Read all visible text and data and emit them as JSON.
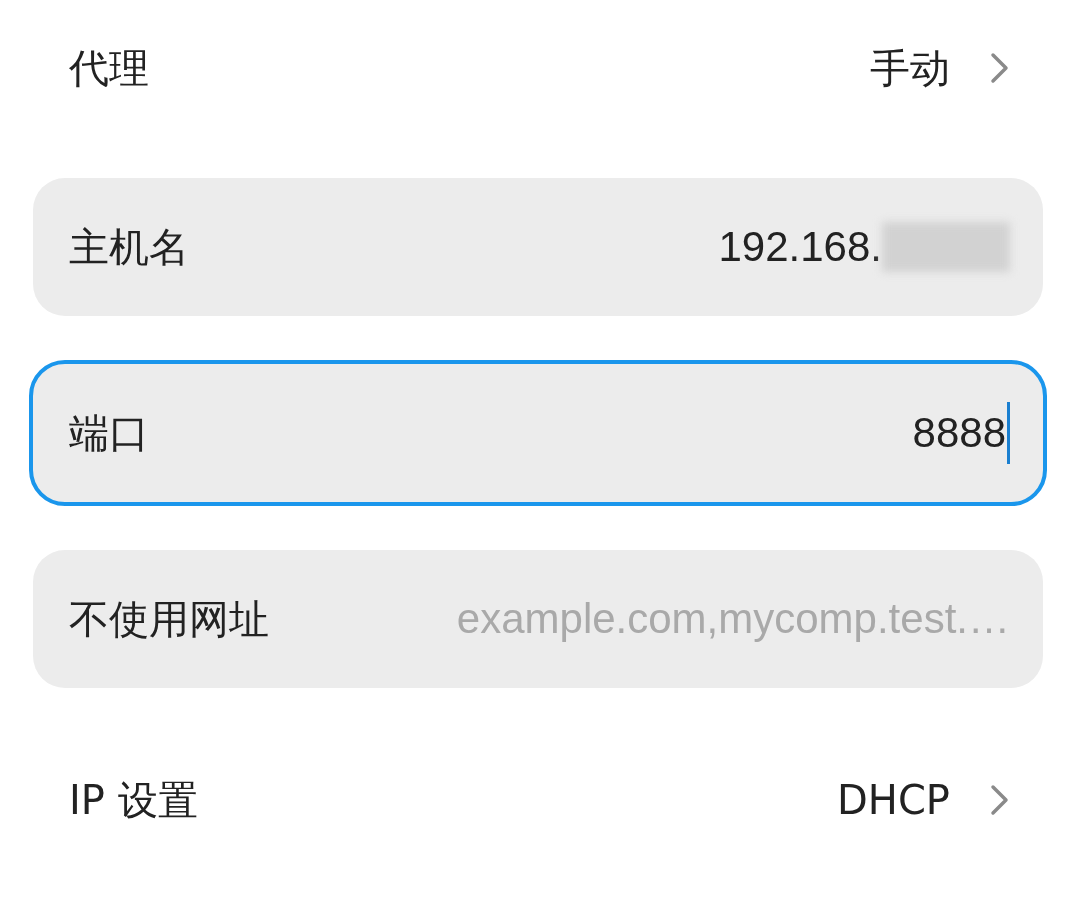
{
  "proxy": {
    "label": "代理",
    "value": "手动"
  },
  "fields": [
    {
      "label": "主机名",
      "value": "192.168.",
      "redacted": true,
      "focused": false
    },
    {
      "label": "端口",
      "value": "8888",
      "focused": true
    },
    {
      "label": "不使用网址",
      "placeholder": "example.com,mycomp.test.…",
      "focused": false
    }
  ],
  "ip_settings": {
    "label": "IP 设置",
    "value": "DHCP"
  }
}
